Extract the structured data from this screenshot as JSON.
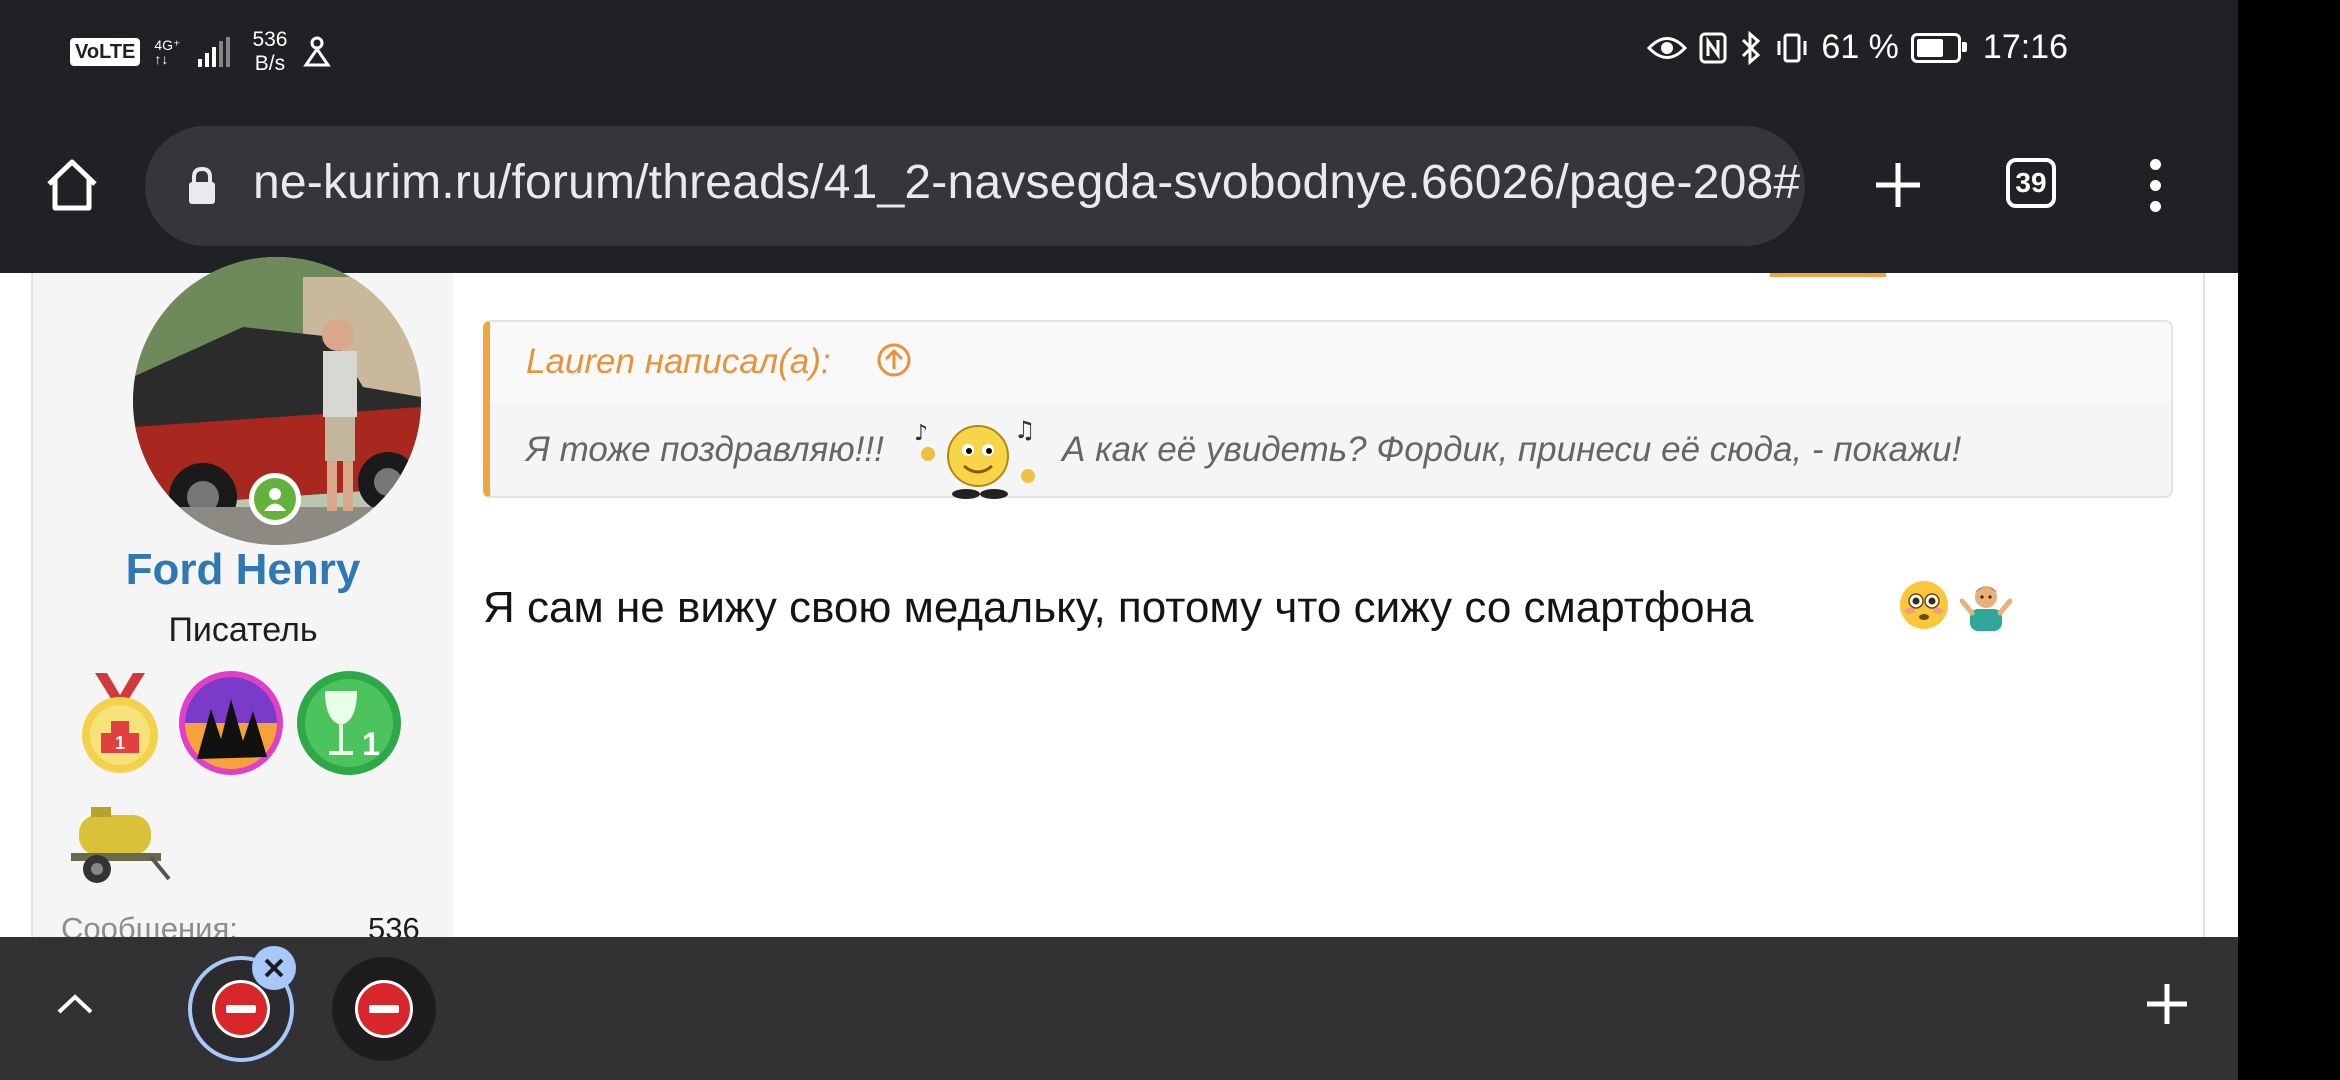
{
  "status_bar": {
    "volte": "VoLTE",
    "network": "4G⁺",
    "network_sub": "↑↓",
    "speed_value": "536",
    "speed_unit": "B/s",
    "battery_percent": "61 %",
    "time": "17:16"
  },
  "browser": {
    "url": "ne-kurim.ru/forum/threads/41_2-navsegda-svobodnye.66026/page-208#",
    "tab_count": "39"
  },
  "user": {
    "name": "Ford Henry",
    "title": "Писатель",
    "stat_label": "Сообщения:",
    "stat_value": "536"
  },
  "quote": {
    "author": "Lauren написал(а):",
    "text_before": "Я тоже поздравляю!!!",
    "text_after": "А как её увидеть? Фордик, принеси её сюда, - покажи!"
  },
  "post": {
    "text": "Я сам не вижу свою медальку, потому что сижу со смартфона"
  },
  "icons": [
    "home-icon",
    "lock-icon",
    "plus-icon",
    "tabs-icon",
    "more-icon",
    "arrow-up-icon",
    "caret-up-icon",
    "blocked-site-icon",
    "close-icon"
  ],
  "colors": {
    "chrome_bg": "#202124",
    "omnibox_bg": "#35363a",
    "username": "#2f78b4",
    "quote_accent": "#f0a542",
    "bottom_bar": "#323234",
    "tab_active_ring": "#a8c7fa"
  }
}
